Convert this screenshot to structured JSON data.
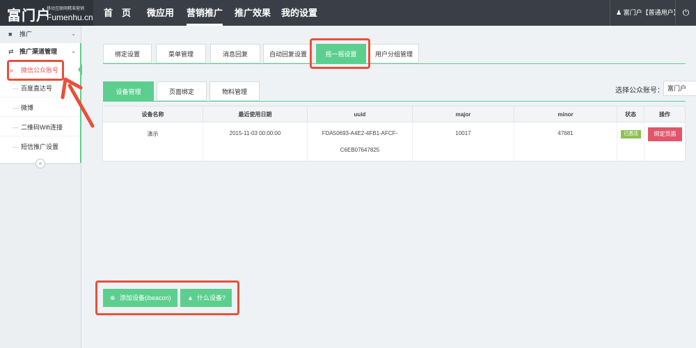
{
  "logo": {
    "main": "富门户",
    "tagline": "移动互联网精准营销",
    "domain": "Fumenhu.cn"
  },
  "nav": {
    "items": [
      "首　页",
      "微应用",
      "营销推广",
      "推广效果",
      "我的设置"
    ],
    "active": "营销推广"
  },
  "user": {
    "label": "富门户【普通用户】",
    "icon": "user-icon",
    "power_icon": "power-icon"
  },
  "sidebar": {
    "section_promo": "推广",
    "section_channel": "推广渠道管理",
    "items": [
      "微信公众账号",
      "百度直达号",
      "微博",
      "二维码Wifi连接",
      "短信推广设置"
    ],
    "active": "微信公众账号",
    "collapse_glyph": "«"
  },
  "tabs_primary": [
    "绑定设置",
    "菜单管理",
    "消息回复",
    "自动回复设置",
    "摇一摇设置",
    "用户分组管理"
  ],
  "tabs_primary_active": "摇一摇设置",
  "tabs_secondary": [
    "设备管理",
    "页面绑定",
    "物料管理"
  ],
  "tabs_secondary_active": "设备管理",
  "account": {
    "label": "选择公众账号：",
    "selected": "富门户"
  },
  "table": {
    "headers": [
      "设备名称",
      "最近使用日期",
      "uuid",
      "major",
      "minor",
      "状态",
      "操作"
    ],
    "rows": [
      {
        "name": "演示",
        "date": "2015-11-03 00:00:00",
        "uuid_line1": "FDA50693-A4E2-4FB1-AFCF-",
        "uuid_line2": "C6EB07647825",
        "major": "10017",
        "minor": "47681",
        "status": "已激活",
        "action": "绑定页面"
      }
    ]
  },
  "buttons": {
    "add_device": "添加设备(ibeacon)",
    "what_device": "什么设备?"
  },
  "colors": {
    "accent_green": "#5ccf8f",
    "highlight_red": "#e8503a",
    "danger": "#e2566b",
    "topbar": "#3a3f47"
  }
}
